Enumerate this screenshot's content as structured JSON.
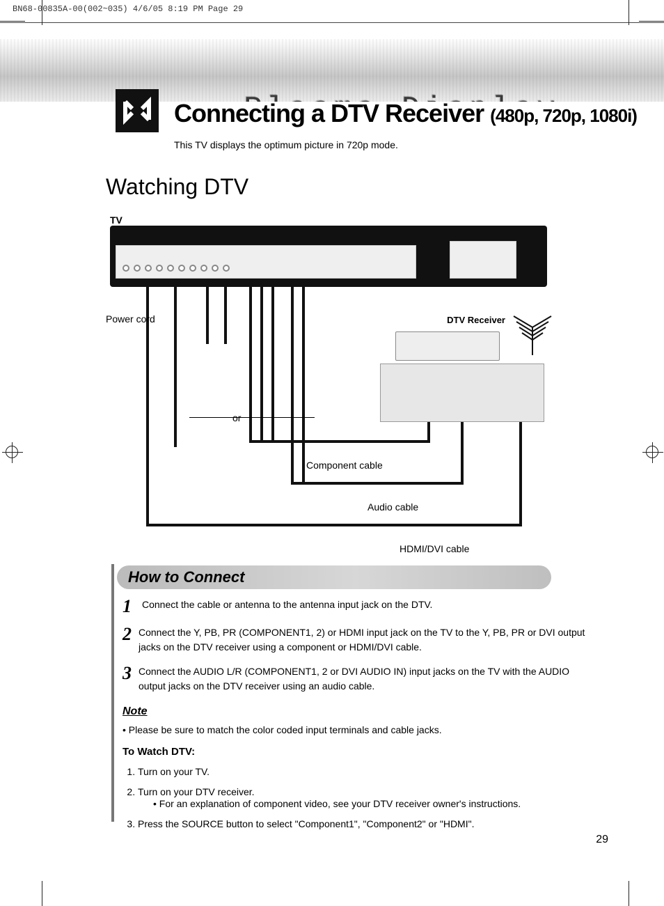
{
  "page_number": 29,
  "imposition_line": "BN68-00835A-00(002~035)  4/6/05  8:19 PM  Page 29",
  "header": {
    "banner_title": "Plasma Display",
    "main_title": "Connecting a DTV Receiver",
    "main_title_sub": "(480p, 720p, 1080i)",
    "subtext": "This TV displays the optimum picture in 720p mode."
  },
  "section_title": "Watching DTV",
  "diagram": {
    "tv_label": "TV",
    "power_cord": "Power cord",
    "or_label": "or",
    "dtv_receiver": "DTV Receiver",
    "component_cable": "Component cable",
    "audio_cable": "Audio cable",
    "hdmi_dvi_cable": "HDMI/DVI cable"
  },
  "how_to_connect": {
    "title": "How to Connect",
    "steps": [
      {
        "num": "1",
        "text": "Connect the cable or antenna to the antenna input jack on the DTV."
      },
      {
        "num": "2",
        "text": "Connect the Y, PB, PR (COMPONENT1, 2) or HDMI input jack on the TV to the Y, PB, PR or DVI output jacks on the DTV receiver using a component or HDMI/DVI cable."
      },
      {
        "num": "3",
        "text": "Connect the AUDIO L/R (COMPONENT1, 2 or DVI AUDIO IN) input jacks on the TV with the AUDIO output jacks on the DTV receiver using an audio cable."
      }
    ],
    "note_label": "Note",
    "note_text": "Please be sure to match the color coded input terminals and cable jacks.",
    "to_watch_title": "To Watch DTV:",
    "to_watch": [
      {
        "num": "1.",
        "text": "Turn on your TV.",
        "sub": ""
      },
      {
        "num": "2.",
        "text": "Turn on your DTV receiver.",
        "sub": "• For an explanation of component video, see your DTV receiver owner's instructions."
      },
      {
        "num": "3.",
        "text": "Press the SOURCE button to select \"Component1\", \"Component2\" or \"HDMI\".",
        "sub": ""
      }
    ]
  }
}
